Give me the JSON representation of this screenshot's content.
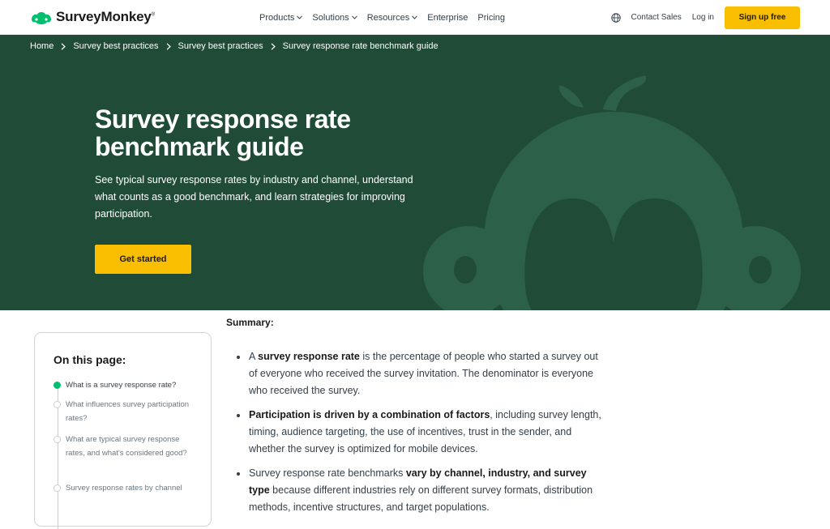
{
  "brand": {
    "name": "SurveyMonkey",
    "reg": "®",
    "logo_color": "#00bf6f"
  },
  "nav": {
    "items": [
      {
        "label": "Products",
        "dropdown": true
      },
      {
        "label": "Solutions",
        "dropdown": true
      },
      {
        "label": "Resources",
        "dropdown": true
      },
      {
        "label": "Enterprise",
        "dropdown": false
      },
      {
        "label": "Pricing",
        "dropdown": false
      }
    ],
    "contact": "Contact Sales",
    "login": "Log in",
    "signup": "Sign up free"
  },
  "breadcrumb": [
    "Home",
    "Survey best practices",
    "Survey best practices",
    "Survey response rate benchmark guide"
  ],
  "hero": {
    "title": "Survey response rate benchmark guide",
    "description": "See typical survey response rates by industry and channel, understand what counts as a good benchmark, and learn strategies for improving participation.",
    "cta": "Get started",
    "bg_color": "#1f4b37",
    "cta_color": "#f9be00"
  },
  "toc": {
    "title": "On this page:",
    "items": [
      {
        "label": "What is a survey response rate?",
        "active": true
      },
      {
        "label": "What influences survey participation rates?",
        "active": false
      },
      {
        "label": "What are typical survey response rates, and what's considered good?",
        "active": false
      },
      {
        "label": "Survey response rates by channel",
        "active": false
      }
    ]
  },
  "summary": {
    "label": "Summary:",
    "bullets": [
      {
        "pre": "A ",
        "bold": "survey response rate",
        "post": " is the percentage of people who started a survey out of everyone who received the survey invitation. The denominator is everyone who received the survey."
      },
      {
        "pre": "",
        "bold": "Participation is driven by a combination of factors",
        "post": ", including survey length, timing, audience targeting, the use of incentives, trust in the sender, and whether the survey is optimized for mobile devices."
      },
      {
        "pre": "Survey response rate benchmarks ",
        "bold": "vary by channel, industry, and survey type",
        "post": " because different industries rely on different survey formats, distribution methods, incentive structures, and target populations."
      }
    ]
  }
}
